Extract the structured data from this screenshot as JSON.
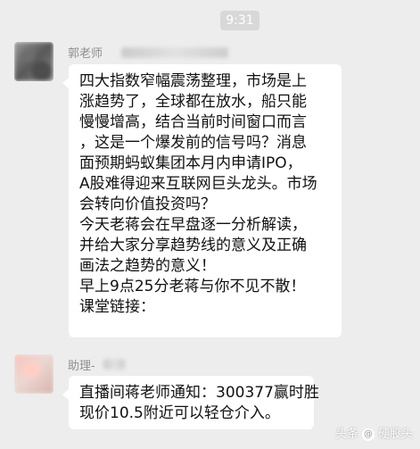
{
  "chat": {
    "timestamp": "9:31",
    "messages": [
      {
        "sender": "郭老师",
        "lines": [
          "四大指数窄幅震荡整理，市场是上",
          "涨趋势了，全球都在放水，船只能",
          "慢慢增高，结合当前时间窗口而言",
          "，这是一个爆发前的信号吗？消息",
          "面预期蚂蚁集团本月内申请IPO，",
          "A股难得迎来互联网巨头龙头。市场",
          "会转向价值投资吗？",
          "今天老蒋会在早盘逐一分析解读，",
          "并给大家分享趋势线的意义及正确",
          "画法之趋势的意义！",
          "早上9点25分老蒋与你不见不散！",
          "课堂链接："
        ]
      },
      {
        "sender": "助理-",
        "lines": [
          "直播间蒋老师通知：300377赢时胜",
          "现价10.5附近可以轻仓介入。"
        ]
      }
    ]
  },
  "watermark": {
    "source": "头条",
    "at_symbol": "@",
    "handle": "硬股头"
  }
}
